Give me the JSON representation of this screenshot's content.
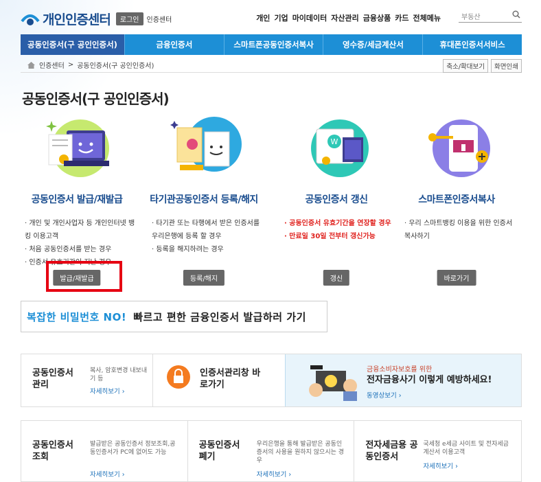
{
  "header": {
    "logo": "개인인증센터",
    "login": "로그인",
    "center": "인증센터",
    "nav": [
      "개인",
      "기업",
      "마이데이터",
      "자산관리",
      "금융상품",
      "카드",
      "전체메뉴"
    ],
    "search_placeholder": "부동산"
  },
  "gnb": [
    "공동인증서(구 공인인증서)",
    "금융인증서",
    "스마트폰공동인증서복사",
    "영수증/세금계산서",
    "휴대폰인증서서비스"
  ],
  "breadcrumb": {
    "home": "인증센터",
    "sep": ">",
    "current": "공동인증서(구 공인인증서)",
    "zoom": "축소/확대보기",
    "print": "화면인쇄"
  },
  "page_title": "공동인증서(구 공인인증서)",
  "columns": [
    {
      "title": "공동인증서 발급/재발급",
      "items": [
        {
          "t": "개인 및 개인사업자 등 개인인터넷 뱅킹 이용고객",
          "red": false
        },
        {
          "t": "처음 공동인증서를 받는 경우",
          "red": false
        },
        {
          "t": "인증서 유효기간이 지난 경우",
          "red": false
        }
      ],
      "button": "발급/재발급"
    },
    {
      "title": "타기관공동인증서 등록/해지",
      "items": [
        {
          "t": "타기관 또는 타행에서 받은 인증서를 우리은행에 등록 할 경우",
          "red": false
        },
        {
          "t": "등록을 해지하려는 경우",
          "red": false
        }
      ],
      "button": "등록/해지"
    },
    {
      "title": "공동인증서 갱신",
      "items": [
        {
          "t": "공동인증서 유효기간을 연장할 경우",
          "red": true
        },
        {
          "t": "만료일 30일 전부터 갱신가능",
          "red": true
        }
      ],
      "button": "갱신"
    },
    {
      "title": "스마트폰인증서복사",
      "items": [
        {
          "t": "우리 스마트뱅킹 이용을 위한 인증서 복사하기",
          "red": false
        }
      ],
      "button": "바로가기"
    }
  ],
  "banner": {
    "part1": "복잡한 비밀번호 NO!",
    "part2": "빠르고 편한 금융인증서 발급하러 가기"
  },
  "row2": {
    "manage_title": "공동인증서 관리",
    "manage_desc": "복사, 암호변경 내보내기 등",
    "manage_more": "자세히보기 ›",
    "shortcut_title": "인증서관리창 바로가기",
    "promo_sub": "금융소비자보호를 위한",
    "promo_title": "전자금융사기 이렇게 예방하세요!",
    "promo_more": "동영상보기 ›"
  },
  "row3": [
    {
      "title": "공동인증서 조회",
      "desc": "발급받은 공동인증서 정보조회,공동인증서가 PC에 없어도 가능",
      "more": "자세히보기 ›"
    },
    {
      "title": "공동인증서 폐기",
      "desc": "우리은행을 통해 발급받은 공동인증서의 사용을 원하지 않으시는 경우",
      "more": "자세히보기 ›"
    },
    {
      "title": "전자세금용 공동인증서",
      "desc": "국세청 e세금 사이트 및 전자세금계산서 이용고객",
      "more": "자세히보기 ›"
    }
  ]
}
